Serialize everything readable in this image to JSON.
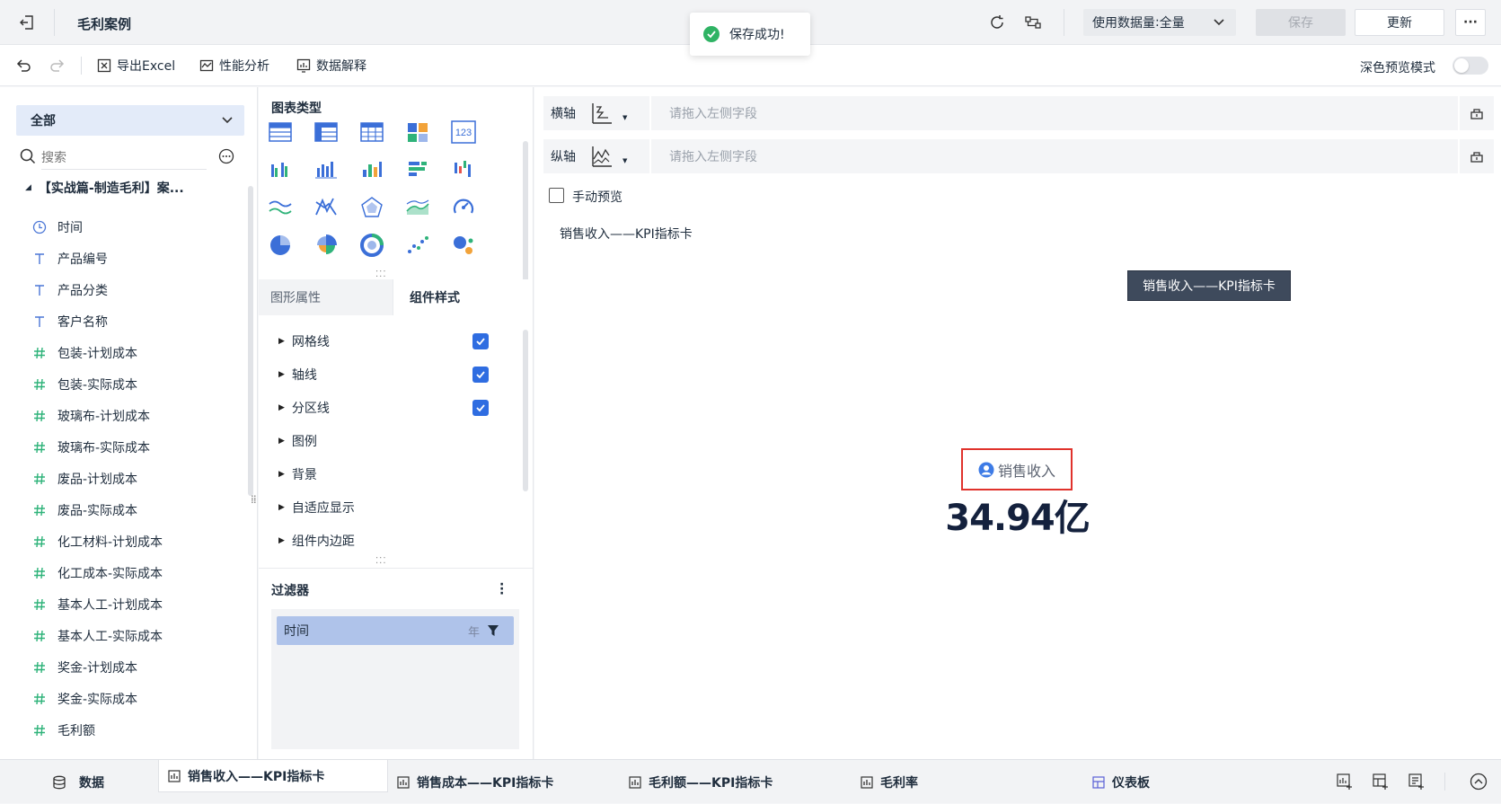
{
  "topbar": {
    "title": "毛利案例",
    "data_amount_label": "使用数据量",
    "data_amount_value": "全量",
    "save_label": "保存",
    "update_label": "更新",
    "more_label": "···"
  },
  "toast": {
    "text": "保存成功!"
  },
  "toolbar": {
    "export_label": "导出Excel",
    "performance_label": "性能分析",
    "explain_label": "数据解释",
    "dark_mode_label": "深色预览模式"
  },
  "sidebar": {
    "scope_label": "全部",
    "search_placeholder": "搜索",
    "table_name": "【实战篇-制造毛利】案...",
    "fields": [
      {
        "type": "date",
        "label": "时间"
      },
      {
        "type": "text",
        "label": "产品编号"
      },
      {
        "type": "text",
        "label": "产品分类"
      },
      {
        "type": "text",
        "label": "客户名称"
      },
      {
        "type": "number",
        "label": "包装-计划成本"
      },
      {
        "type": "number",
        "label": "包装-实际成本"
      },
      {
        "type": "number",
        "label": "玻璃布-计划成本"
      },
      {
        "type": "number",
        "label": "玻璃布-实际成本"
      },
      {
        "type": "number",
        "label": "废品-计划成本"
      },
      {
        "type": "number",
        "label": "废品-实际成本"
      },
      {
        "type": "number",
        "label": "化工材料-计划成本"
      },
      {
        "type": "number",
        "label": "化工成本-实际成本"
      },
      {
        "type": "number",
        "label": "基本人工-计划成本"
      },
      {
        "type": "number",
        "label": "基本人工-实际成本"
      },
      {
        "type": "number",
        "label": "奖金-计划成本"
      },
      {
        "type": "number",
        "label": "奖金-实际成本"
      },
      {
        "type": "number",
        "label": "毛利额"
      }
    ]
  },
  "chart_panel": {
    "chart_type_title": "图表类型",
    "kpi_icon_label": "123",
    "tabs": [
      "图形属性",
      "组件样式"
    ],
    "properties": [
      {
        "label": "网格线",
        "checked": true
      },
      {
        "label": "轴线",
        "checked": true
      },
      {
        "label": "分区线",
        "checked": true
      },
      {
        "label": "图例",
        "checked": false
      },
      {
        "label": "背景",
        "checked": false
      },
      {
        "label": "自适应显示",
        "checked": false
      },
      {
        "label": "组件内边距",
        "checked": false
      }
    ],
    "filter_title": "过滤器",
    "filter_item": {
      "label": "时间",
      "granularity": "年"
    }
  },
  "canvas": {
    "x_axis_label": "横轴",
    "y_axis_label": "纵轴",
    "drop_placeholder": "请拖入左侧字段",
    "manual_preview_label": "手动预览",
    "component_title": "销售收入——KPI指标卡",
    "tooltip_text": "销售收入——KPI指标卡",
    "kpi_name": "销售收入",
    "kpi_value": "34.94亿",
    "accent_color": "#2f6de1",
    "highlight_color": "#e0322c"
  },
  "bottom_tabs": [
    {
      "label": "数据",
      "icon": "database-icon"
    },
    {
      "label": "销售收入——KPI指标卡",
      "icon": "chart-icon",
      "active": true
    },
    {
      "label": "销售成本——KPI指标卡",
      "icon": "chart-icon"
    },
    {
      "label": "毛利额——KPI指标卡",
      "icon": "chart-icon"
    },
    {
      "label": "毛利率",
      "icon": "chart-icon"
    },
    {
      "label": "仪表板",
      "icon": "dashboard-icon"
    }
  ]
}
